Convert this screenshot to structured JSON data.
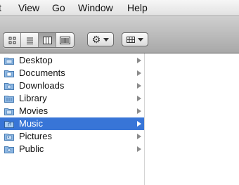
{
  "menubar": {
    "items": [
      "t",
      "View",
      "Go",
      "Window",
      "Help"
    ]
  },
  "toolbar": {
    "view_modes": [
      "icon-view-icon",
      "list-view-icon",
      "column-view-icon",
      "coverflow-view-icon"
    ],
    "active_view": "column",
    "action_icon": "gear-icon",
    "arrange_icon": "arrange-grid-icon"
  },
  "sidebar": {
    "items": [
      {
        "label": "Desktop",
        "icon": "desktop-folder-icon",
        "selected": false
      },
      {
        "label": "Documents",
        "icon": "documents-folder-icon",
        "selected": false
      },
      {
        "label": "Downloads",
        "icon": "downloads-folder-icon",
        "selected": false
      },
      {
        "label": "Library",
        "icon": "library-folder-icon",
        "selected": false
      },
      {
        "label": "Movies",
        "icon": "movies-folder-icon",
        "selected": false
      },
      {
        "label": "Music",
        "icon": "music-folder-icon",
        "selected": true
      },
      {
        "label": "Pictures",
        "icon": "pictures-folder-icon",
        "selected": false
      },
      {
        "label": "Public",
        "icon": "public-folder-icon",
        "selected": false
      }
    ]
  },
  "colors": {
    "selection": "#3875d7",
    "folder": "#6f9fd0"
  }
}
